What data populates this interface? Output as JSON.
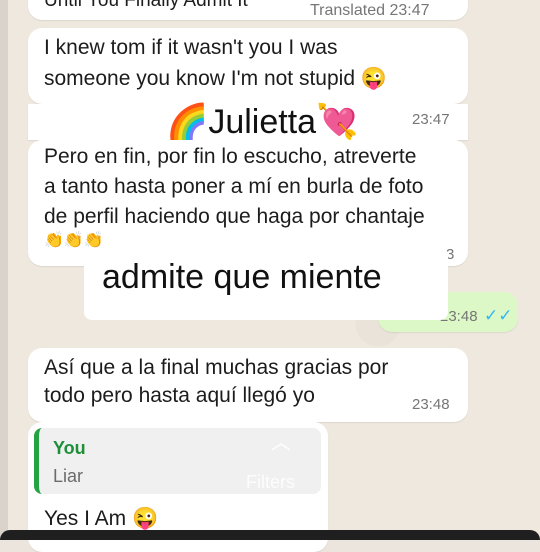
{
  "top_partial": {
    "text": "Until You Finally Admit It",
    "translated": "Translated",
    "time": "23:47"
  },
  "msg1": {
    "text_line1": "I knew tom if it wasn't you I was",
    "text_line2": "someone you know I'm not stupid",
    "emoji": "😜",
    "time": "23:47"
  },
  "sender_overlay": {
    "emoji_left": "🌈",
    "name": "Julietta",
    "emoji_right": "💘"
  },
  "msg2": {
    "line1": "Pero en fin, por fin lo escucho, atreverte",
    "line2": "a tanto hasta poner a mí en burla de foto",
    "line3": "de perfil haciendo que haga por chantaje",
    "emoji_row": "👏👏👏",
    "time_partial": "3"
  },
  "caption": {
    "text": "admite que miente"
  },
  "outgoing": {
    "time": "23:48",
    "ticks": "✓✓"
  },
  "msg3": {
    "line1": "Así que a la final muchas gracias por",
    "line2": "todo pero hasta aquí llegó yo",
    "time": "23:48"
  },
  "reply": {
    "name": "You",
    "text": "Liar",
    "chevron": "︿"
  },
  "watermark": {
    "text": "Filters"
  },
  "msg4": {
    "text": "Yes I Am",
    "emoji": "😜"
  },
  "colors": {
    "incoming": "#ffffff",
    "outgoing": "#dcf8c6",
    "read_ticks": "#34b7f1",
    "reply_accent": "#25a244"
  }
}
